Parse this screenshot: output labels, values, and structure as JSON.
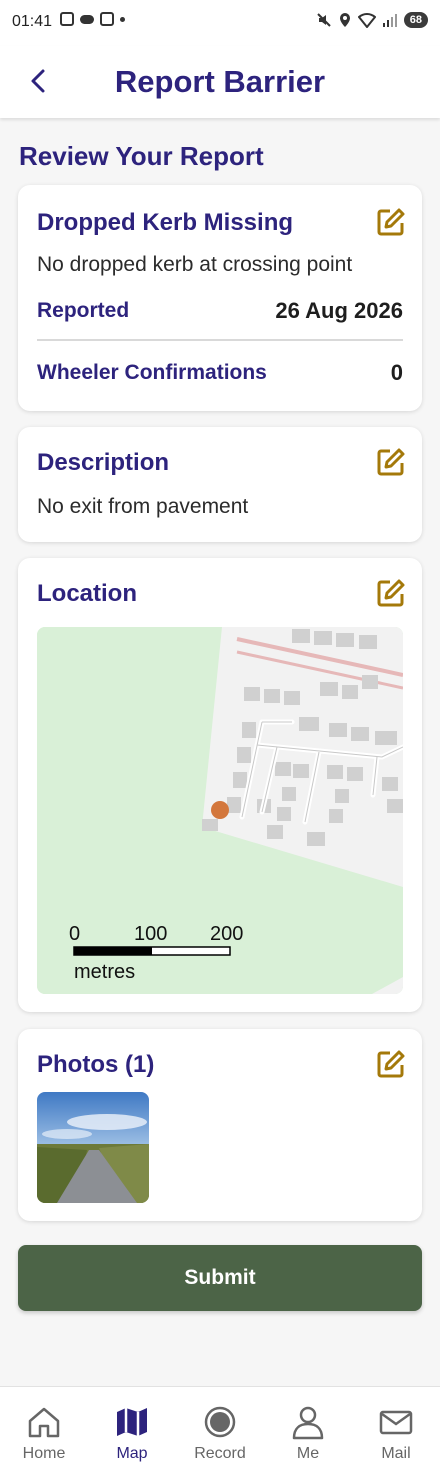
{
  "status_bar": {
    "time": "01:41",
    "battery": "68"
  },
  "header": {
    "title": "Report Barrier"
  },
  "review": {
    "title": "Review Your Report"
  },
  "barrier_card": {
    "title": "Dropped Kerb Missing",
    "subtitle": "No dropped kerb at crossing point",
    "reported_label": "Reported",
    "reported_value": "26 Aug 2026",
    "confirmations_label": "Wheeler Confirmations",
    "confirmations_value": "0"
  },
  "description_card": {
    "title": "Description",
    "text": "No exit from pavement"
  },
  "location_card": {
    "title": "Location",
    "scale": {
      "labels": [
        "0",
        "100",
        "200"
      ],
      "unit": "metres"
    }
  },
  "photos_card": {
    "title": "Photos (1)"
  },
  "submit": {
    "label": "Submit"
  },
  "bottom_nav": {
    "items": [
      {
        "label": "Home",
        "icon": "home-icon",
        "active": false
      },
      {
        "label": "Map",
        "icon": "map-icon",
        "active": true
      },
      {
        "label": "Record",
        "icon": "record-icon",
        "active": false
      },
      {
        "label": "Me",
        "icon": "person-icon",
        "active": false
      },
      {
        "label": "Mail",
        "icon": "mail-icon",
        "active": false
      }
    ]
  },
  "colors": {
    "primary": "#2d237d",
    "edit_icon": "#a4790a",
    "submit": "#4c6447",
    "marker": "#d3773c",
    "map_green": "#d9f0d7"
  }
}
